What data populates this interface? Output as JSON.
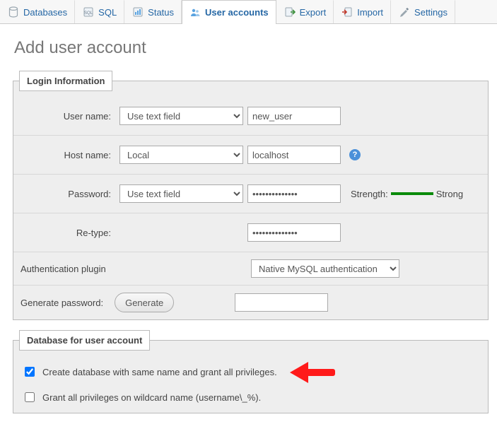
{
  "tabs": {
    "databases": "Databases",
    "sql": "SQL",
    "status": "Status",
    "user_accounts": "User accounts",
    "export": "Export",
    "import": "Import",
    "settings": "Settings"
  },
  "page_title": "Add user account",
  "legend_login": "Login Information",
  "legend_db": "Database for user account",
  "labels": {
    "username": "User name:",
    "hostname": "Host name:",
    "password": "Password:",
    "retype": "Re-type:",
    "auth_plugin": "Authentication plugin",
    "generate_pw": "Generate password:",
    "strength": "Strength:",
    "strength_value": "Strong"
  },
  "selects": {
    "username_mode": "Use text field",
    "hostname_mode": "Local",
    "password_mode": "Use text field",
    "auth_plugin": "Native MySQL authentication"
  },
  "inputs": {
    "username": "new_user",
    "hostname": "localhost",
    "password": "••••••••••••••",
    "retype": "••••••••••••••",
    "generated": ""
  },
  "buttons": {
    "generate": "Generate"
  },
  "checkboxes": {
    "create_db": "Create database with same name and grant all privileges.",
    "wildcard": "Grant all privileges on wildcard name (username\\_%).",
    "create_db_checked": true,
    "wildcard_checked": false
  }
}
